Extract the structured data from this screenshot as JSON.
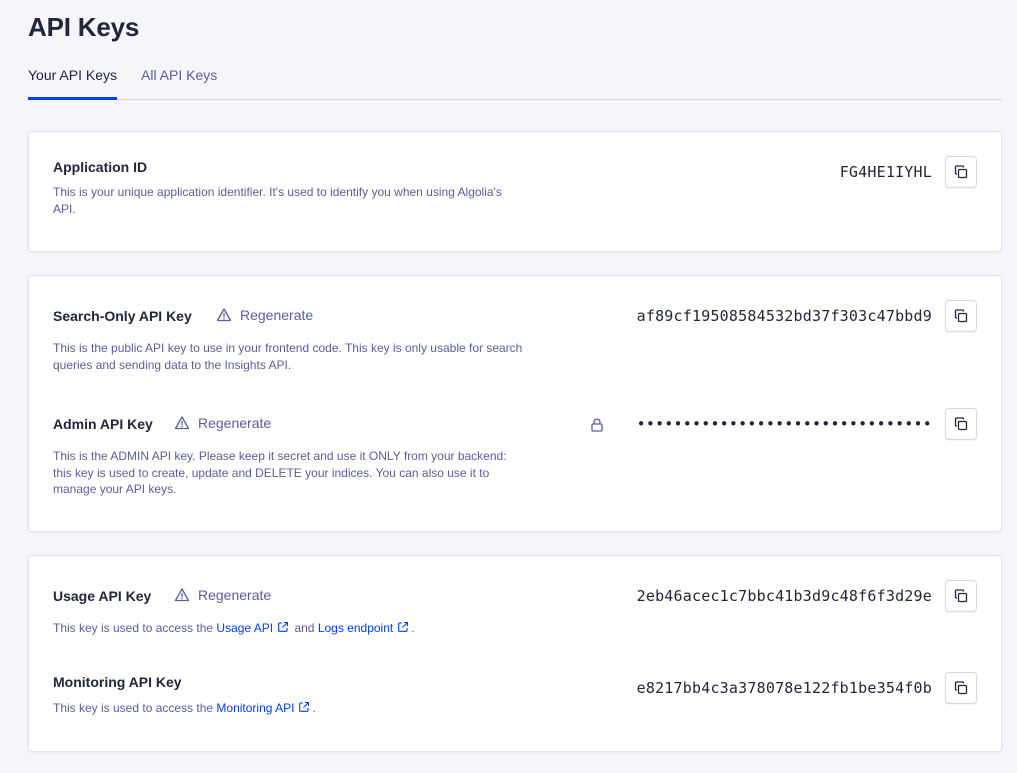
{
  "page": {
    "title": "API Keys"
  },
  "tabs": [
    {
      "label": "Your API Keys",
      "active": true
    },
    {
      "label": "All API Keys",
      "active": false
    }
  ],
  "application_id": {
    "name": "Application ID",
    "description": "This is your unique application identifier. It's used to identify you when using Algolia's API.",
    "value": "FG4HE1IYHL"
  },
  "search_key": {
    "name": "Search-Only API Key",
    "regenerate_label": "Regenerate",
    "description": "This is the public API key to use in your frontend code. This key is only usable for search queries and sending data to the Insights API.",
    "value": "af89cf19508584532bd37f303c47bbd9"
  },
  "admin_key": {
    "name": "Admin API Key",
    "regenerate_label": "Regenerate",
    "description": "This is the ADMIN API key. Please keep it secret and use it ONLY from your backend: this key is used to create, update and DELETE your indices. You can also use it to manage your API keys.",
    "value": "••••••••••••••••••••••••••••••••"
  },
  "usage_key": {
    "name": "Usage API Key",
    "regenerate_label": "Regenerate",
    "description_prefix": "This key is used to access the ",
    "link1": "Usage API",
    "description_mid": " and ",
    "link2": "Logs endpoint",
    "description_suffix": ".",
    "value": "2eb46acec1c7bbc41b3d9c48f6f3d29e"
  },
  "monitoring_key": {
    "name": "Monitoring API Key",
    "description_prefix": "This key is used to access the ",
    "link1": "Monitoring API",
    "description_suffix": ".",
    "value": "e8217bb4c3a378078e122fb1be354f0b"
  },
  "colors": {
    "accent": "#003dff",
    "text": "#23263b",
    "muted": "#5a5e9a",
    "background": "#f5f5fa"
  },
  "icons": [
    "copy-icon",
    "warning-icon",
    "lock-icon",
    "external-link-icon"
  ]
}
